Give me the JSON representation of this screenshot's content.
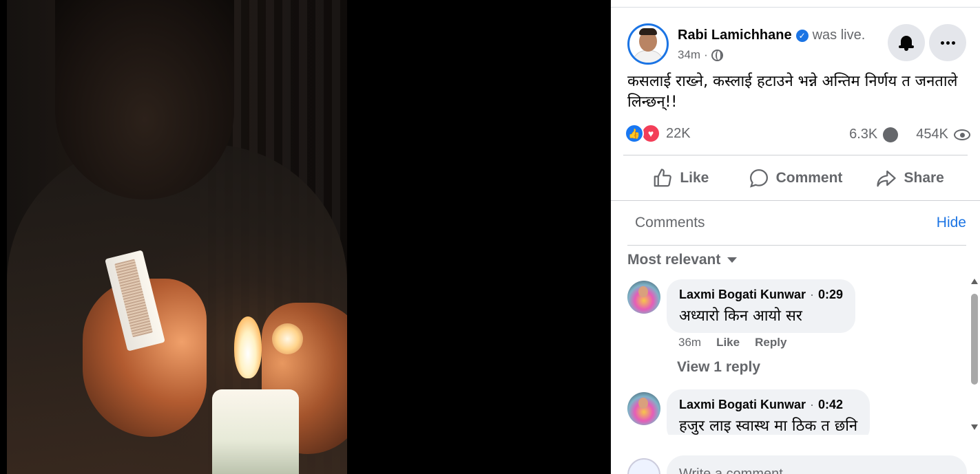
{
  "post": {
    "author": "Rabi Lamichhane",
    "status": "was live.",
    "time": "34m",
    "separator": "·",
    "text": "कसलाई राख्ने, कस्लाई हटाउने भन्ने अन्तिम निर्णय त जनताले लिन्छन्!!"
  },
  "stats": {
    "reactions_count": "22K",
    "comments_count": "6.3K",
    "views_count": "454K"
  },
  "actions": {
    "like": "Like",
    "comment": "Comment",
    "share": "Share"
  },
  "comments_section": {
    "title": "Comments",
    "hide": "Hide",
    "sort": "Most relevant",
    "view_replies": "View 1 reply",
    "write_placeholder": "Write a comment..."
  },
  "comments": [
    {
      "name": "Laxmi Bogati Kunwar",
      "timestamp": "0:29",
      "text": "अध्यारो किन आयो सर",
      "age": "36m",
      "like": "Like",
      "reply": "Reply"
    },
    {
      "name": "Laxmi Bogati Kunwar",
      "timestamp": "0:42",
      "text": "हजुर लाइ स्वास्थ मा ठिक त छनि"
    }
  ],
  "icons": {
    "verified": "verified-badge-icon",
    "privacy": "globe-icon",
    "notify": "bell-icon",
    "more": "more-icon",
    "like": "thumbs-up-icon",
    "comment": "comment-bubble-icon",
    "share": "share-arrow-icon",
    "views": "eye-icon"
  },
  "colors": {
    "accent": "#1b74e4",
    "like_reaction": "#1877f2",
    "love_reaction": "#f33e58",
    "muted_text": "#65676b",
    "comment_bubble_bg": "#f0f2f5"
  }
}
